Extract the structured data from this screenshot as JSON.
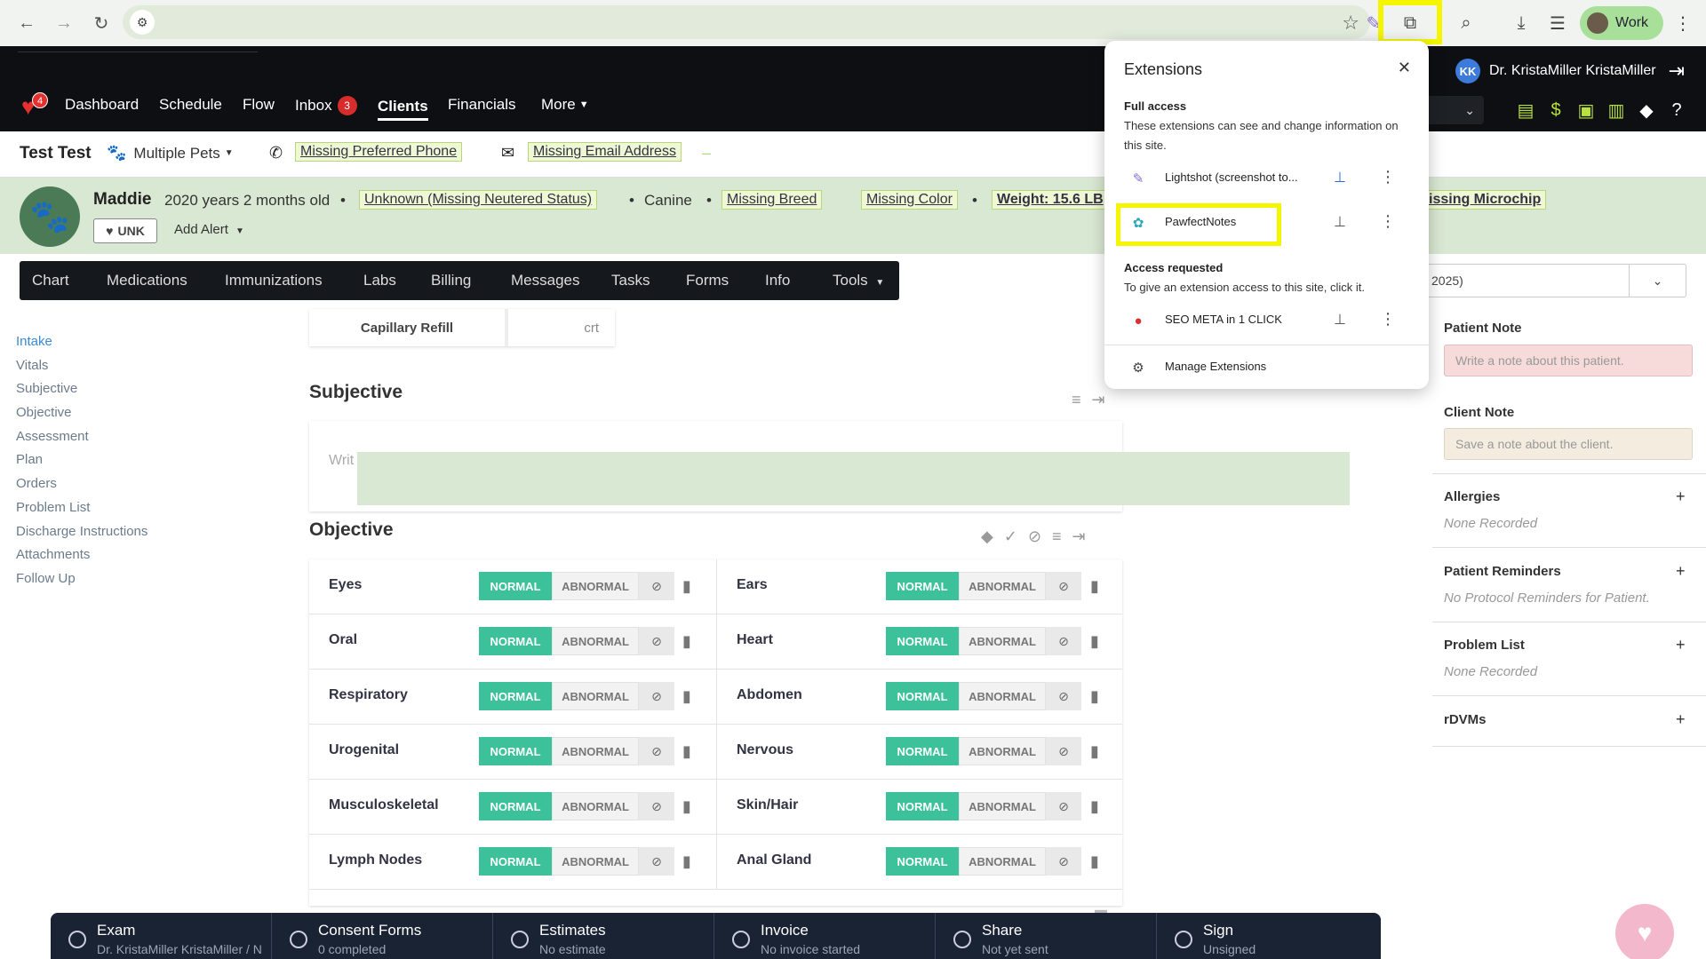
{
  "browser": {
    "profile_label": "Work",
    "icons": [
      "back-icon",
      "forward-icon",
      "reload-icon",
      "site-settings-icon",
      "bookmark-star-icon",
      "lightshot-icon",
      "extensions-puzzle-icon",
      "tab-search-icon",
      "download-icon",
      "reading-list-icon",
      "menu-kebab-icon"
    ]
  },
  "app": {
    "logo_badge": "4",
    "user": {
      "initials": "KK",
      "name": "Dr. KristaMiller KristaMiller"
    },
    "nav": [
      {
        "label": "Dashboard"
      },
      {
        "label": "Schedule"
      },
      {
        "label": "Flow"
      },
      {
        "label": "Inbox",
        "badge": "3"
      },
      {
        "label": "Clients",
        "active": true
      },
      {
        "label": "Financials"
      },
      {
        "label": "More"
      }
    ]
  },
  "client": {
    "name": "Test Test",
    "pets_label": "Multiple Pets",
    "missing_phone": "Missing Preferred Phone",
    "missing_email": "Missing Email Address",
    "dash": "–"
  },
  "patient": {
    "name": "Maddie",
    "age": "2020 years 2 months old",
    "neutered": "Unknown (Missing Neutered Status)",
    "species": "Canine",
    "breed": "Missing Breed",
    "color": "Missing Color",
    "weight": "Weight: 15.6 LB",
    "microchip": "issing Microchip",
    "unk_label": "UNK",
    "add_alert": "Add Alert"
  },
  "tabs": [
    {
      "label": "Chart"
    },
    {
      "label": "Medications"
    },
    {
      "label": "Immunizations"
    },
    {
      "label": "Labs"
    },
    {
      "label": "Billing"
    },
    {
      "label": "Messages"
    },
    {
      "label": "Tasks"
    },
    {
      "label": "Forms"
    },
    {
      "label": "Info"
    },
    {
      "label": "Tools"
    }
  ],
  "date_select": "2025)",
  "side_nav": [
    {
      "label": "Intake",
      "active": true
    },
    {
      "label": "Vitals"
    },
    {
      "label": "Subjective"
    },
    {
      "label": "Objective"
    },
    {
      "label": "Assessment"
    },
    {
      "label": "Plan"
    },
    {
      "label": "Orders"
    },
    {
      "label": "Problem List"
    },
    {
      "label": "Discharge Instructions"
    },
    {
      "label": "Attachments"
    },
    {
      "label": "Follow Up"
    }
  ],
  "vitals_row": {
    "label": "Capillary Refill",
    "value": "crt"
  },
  "subjective": {
    "title": "Subjective",
    "placeholder": "Writ"
  },
  "objective": {
    "title": "Objective",
    "normal_label": "NORMAL",
    "abnormal_label": "ABNORMAL",
    "rows": [
      [
        "Eyes",
        "Ears"
      ],
      [
        "Oral",
        "Heart"
      ],
      [
        "Respiratory",
        "Abdomen"
      ],
      [
        "Urogenital",
        "Nervous"
      ],
      [
        "Musculoskeletal",
        "Skin/Hair"
      ],
      [
        "Lymph Nodes",
        "Anal Gland"
      ]
    ]
  },
  "right_panel": {
    "patient_note_title": "Patient Note",
    "patient_note_placeholder": "Write a note about this patient.",
    "client_note_title": "Client Note",
    "client_note_placeholder": "Save a note about the client.",
    "allergies_title": "Allergies",
    "allergies_empty": "None Recorded",
    "reminders_title": "Patient Reminders",
    "reminders_empty": "No Protocol Reminders for Patient.",
    "problem_list_title": "Problem List",
    "problem_list_empty": "None Recorded",
    "rdvms_title": "rDVMs"
  },
  "bottom_bar": [
    {
      "title": "Exam",
      "sub": "Dr. KristaMiller KristaMiller / N"
    },
    {
      "title": "Consent Forms",
      "sub": "0 completed"
    },
    {
      "title": "Estimates",
      "sub": "No estimate"
    },
    {
      "title": "Invoice",
      "sub": "No invoice started"
    },
    {
      "title": "Share",
      "sub": "Not yet sent"
    },
    {
      "title": "Sign",
      "sub": "Unsigned"
    }
  ],
  "extensions_popup": {
    "title": "Extensions",
    "full_access_title": "Full access",
    "full_access_desc": "These extensions can see and change information on this site.",
    "full_access_items": [
      {
        "name": "Lightshot (screenshot to...",
        "pinned": true
      },
      {
        "name": "PawfectNotes",
        "pinned": false
      }
    ],
    "requested_title": "Access requested",
    "requested_desc": "To give an extension access to this site, click it.",
    "requested_items": [
      {
        "name": "SEO META in 1 CLICK",
        "pinned": false
      }
    ],
    "manage_label": "Manage Extensions"
  },
  "colors": {
    "accent_highlight": "#f5f500",
    "normal_green": "#3cc19b",
    "nav_dark": "#0d0f12",
    "patient_bar": "#d9e8d2",
    "link_blue": "#3a8bd6"
  }
}
